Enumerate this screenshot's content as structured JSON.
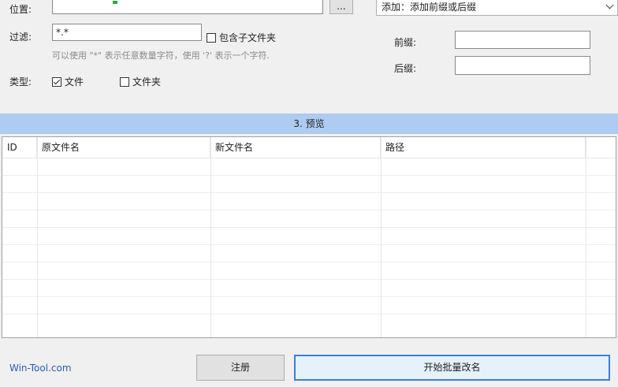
{
  "location": {
    "label": "位置:",
    "browse_label": "..."
  },
  "filter": {
    "label": "过滤:",
    "value": "*.*",
    "include_subfolders_label": "包含子文件夹",
    "include_subfolders_checked": false,
    "hint": "可以使用 \"*\" 表示任意数量字符，使用 '?' 表示一个字符."
  },
  "type": {
    "label": "类型:",
    "file_label": "文件",
    "file_checked": true,
    "folder_label": "文件夹",
    "folder_checked": false
  },
  "rule": {
    "selected": "添加：添加前缀或后缀",
    "prefix_label": "前缀:",
    "prefix_value": "",
    "suffix_label": "后缀:",
    "suffix_value": ""
  },
  "preview": {
    "section_title": "3. 预览",
    "columns": [
      "ID",
      "原文件名",
      "新文件名",
      "路径"
    ]
  },
  "footer": {
    "brand": "Win-Tool.com",
    "register_label": "注册",
    "start_label": "开始批量改名"
  }
}
